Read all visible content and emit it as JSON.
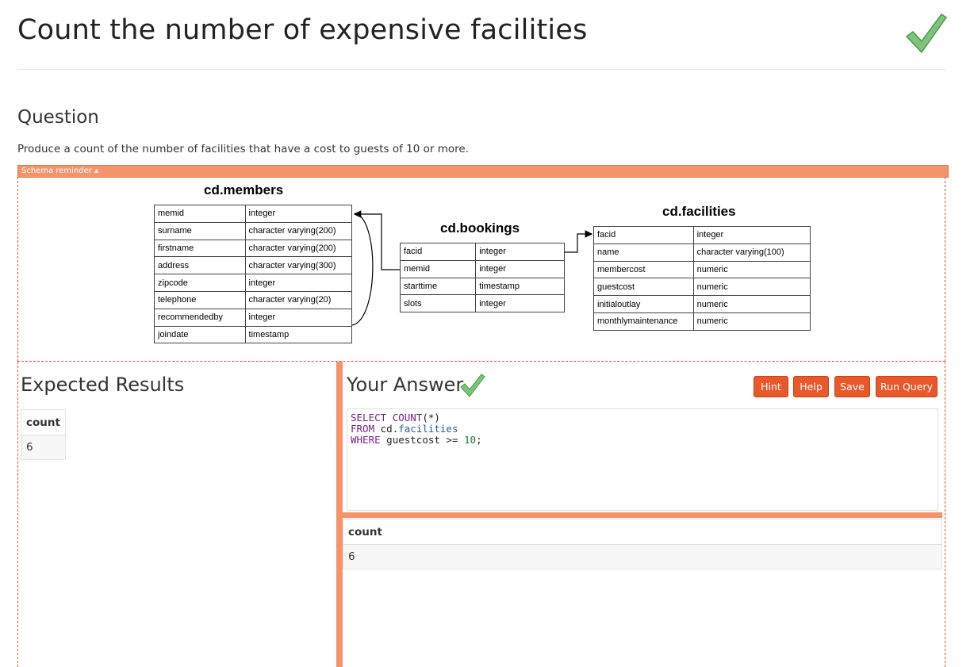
{
  "page": {
    "title": "Count the number of expensive facilities"
  },
  "question": {
    "heading": "Question",
    "text": "Produce a count of the number of facilities that have a cost to guests of 10 or more."
  },
  "schema": {
    "toggle_label": "Schema reminder ▴",
    "tables": [
      {
        "name": "cd.members",
        "columns": [
          [
            "memid",
            "integer"
          ],
          [
            "surname",
            "character varying(200)"
          ],
          [
            "firstname",
            "character varying(200)"
          ],
          [
            "address",
            "character varying(300)"
          ],
          [
            "zipcode",
            "integer"
          ],
          [
            "telephone",
            "character varying(20)"
          ],
          [
            "recommendedby",
            "integer"
          ],
          [
            "joindate",
            "timestamp"
          ]
        ]
      },
      {
        "name": "cd.bookings",
        "columns": [
          [
            "facid",
            "integer"
          ],
          [
            "memid",
            "integer"
          ],
          [
            "starttime",
            "timestamp"
          ],
          [
            "slots",
            "integer"
          ]
        ]
      },
      {
        "name": "cd.facilities",
        "columns": [
          [
            "facid",
            "integer"
          ],
          [
            "name",
            "character varying(100)"
          ],
          [
            "membercost",
            "numeric"
          ],
          [
            "guestcost",
            "numeric"
          ],
          [
            "initialoutlay",
            "numeric"
          ],
          [
            "monthlymaintenance",
            "numeric"
          ]
        ]
      }
    ]
  },
  "expected": {
    "heading": "Expected Results",
    "column": "count",
    "value": "6"
  },
  "answer": {
    "heading": "Your Answer",
    "buttons": {
      "hint": "Hint",
      "help": "Help",
      "save": "Save",
      "run": "Run Query"
    },
    "sql": {
      "line1_kw": "SELECT",
      "line1_fn": "COUNT",
      "line1_rest": "(*)",
      "line2_kw": "FROM",
      "line2_schema": "cd.",
      "line2_table": "facilities",
      "line3_kw": "WHERE",
      "line3_col": "guestcost >=",
      "line3_num": "10",
      "line3_end": ";"
    },
    "result_column": "count",
    "result_value": "6"
  },
  "colors": {
    "accent": "#f5946b",
    "button": "#e8582a",
    "check": "#5cb85c"
  }
}
